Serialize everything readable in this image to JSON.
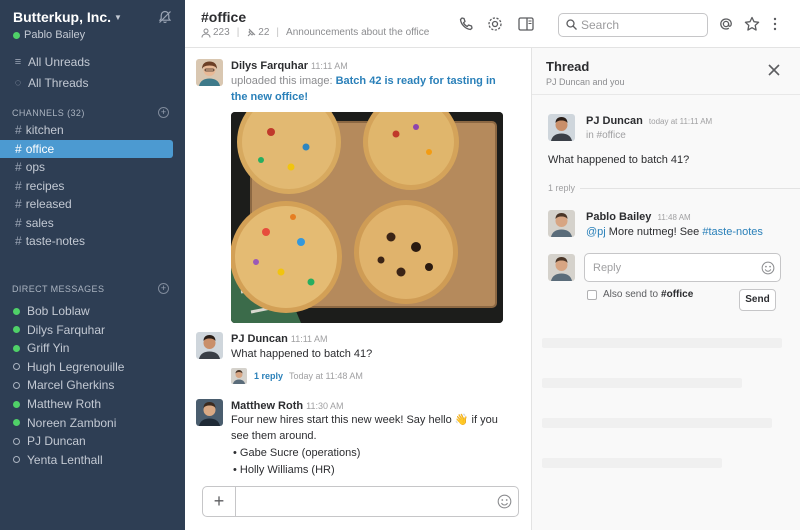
{
  "workspace": {
    "team_name": "Butterkup, Inc.",
    "user_name": "Pablo Bailey"
  },
  "sidebar": {
    "all_unreads": "All Unreads",
    "all_threads": "All Threads",
    "channels_header": "CHANNELS",
    "channels_count": "(32)",
    "channels": [
      {
        "name": "kitchen",
        "active": false
      },
      {
        "name": "office",
        "active": true
      },
      {
        "name": "ops",
        "active": false
      },
      {
        "name": "recipes",
        "active": false
      },
      {
        "name": "released",
        "active": false
      },
      {
        "name": "sales",
        "active": false
      },
      {
        "name": "taste-notes",
        "active": false
      }
    ],
    "dm_header": "DIRECT MESSAGES",
    "direct_messages": [
      {
        "name": "Bob Loblaw",
        "online": true
      },
      {
        "name": "Dilys Farquhar",
        "online": true
      },
      {
        "name": "Griff Yin",
        "online": true
      },
      {
        "name": "Hugh Legrenouille",
        "online": false
      },
      {
        "name": "Marcel Gherkins",
        "online": false
      },
      {
        "name": "Matthew Roth",
        "online": true
      },
      {
        "name": "Noreen Zamboni",
        "online": true
      },
      {
        "name": "PJ Duncan",
        "online": false
      },
      {
        "name": "Yenta Lenthall",
        "online": false
      }
    ]
  },
  "header": {
    "channel_title": "#office",
    "member_count": "223",
    "pinned_count": "22",
    "topic": "Announcements about the office",
    "search_placeholder": "Search"
  },
  "messages": {
    "m1": {
      "author": "Dilys Farquhar",
      "time": "11:11 AM",
      "prefix": "uploaded this image:",
      "link_line1": "Batch 42 is ready for tasting in",
      "link_line2": "the new office!"
    },
    "m2": {
      "author": "PJ Duncan",
      "time": "11:11 AM",
      "text": "What happened to batch 41?",
      "reply_count": "1 reply",
      "reply_time": "Today at 11:48 AM"
    },
    "m3": {
      "author": "Matthew Roth",
      "time": "11:30 AM",
      "text_line1": "Four new hires start this new week! Say hello",
      "emoji": "👋",
      "text_line1_end": "if you",
      "text_line2": "see them around.",
      "bullets": [
        "Gabe Sucre (operations)",
        "Holly Williams (HR)"
      ]
    }
  },
  "composer": {
    "plus_label": "+"
  },
  "thread": {
    "title": "Thread",
    "participants": "PJ Duncan and you",
    "parent": {
      "author": "PJ Duncan",
      "time": "today at 11:11 AM",
      "channel": "in #office",
      "text": "What happened to batch 41?"
    },
    "reply_divider": "1 reply",
    "reply": {
      "author": "Pablo Bailey",
      "time": "11:48 AM",
      "mention": "@pj",
      "text": "More nutmeg! See",
      "channel_link": "#taste-notes"
    },
    "reply_placeholder": "Reply",
    "also_send_label": "Also send to",
    "also_send_channel": "#office",
    "send_label": "Send"
  },
  "colors": {
    "sidebar_bg": "#2e3e54",
    "active_channel": "#4c9ad1",
    "online": "#4fd168",
    "link": "#2a80b9"
  },
  "icons": [
    "bell-off-icon",
    "phone-icon",
    "gear-icon",
    "sidebar-toggle-icon",
    "search-icon",
    "mention-icon",
    "star-icon",
    "more-icon",
    "close-icon",
    "emoji-icon"
  ]
}
